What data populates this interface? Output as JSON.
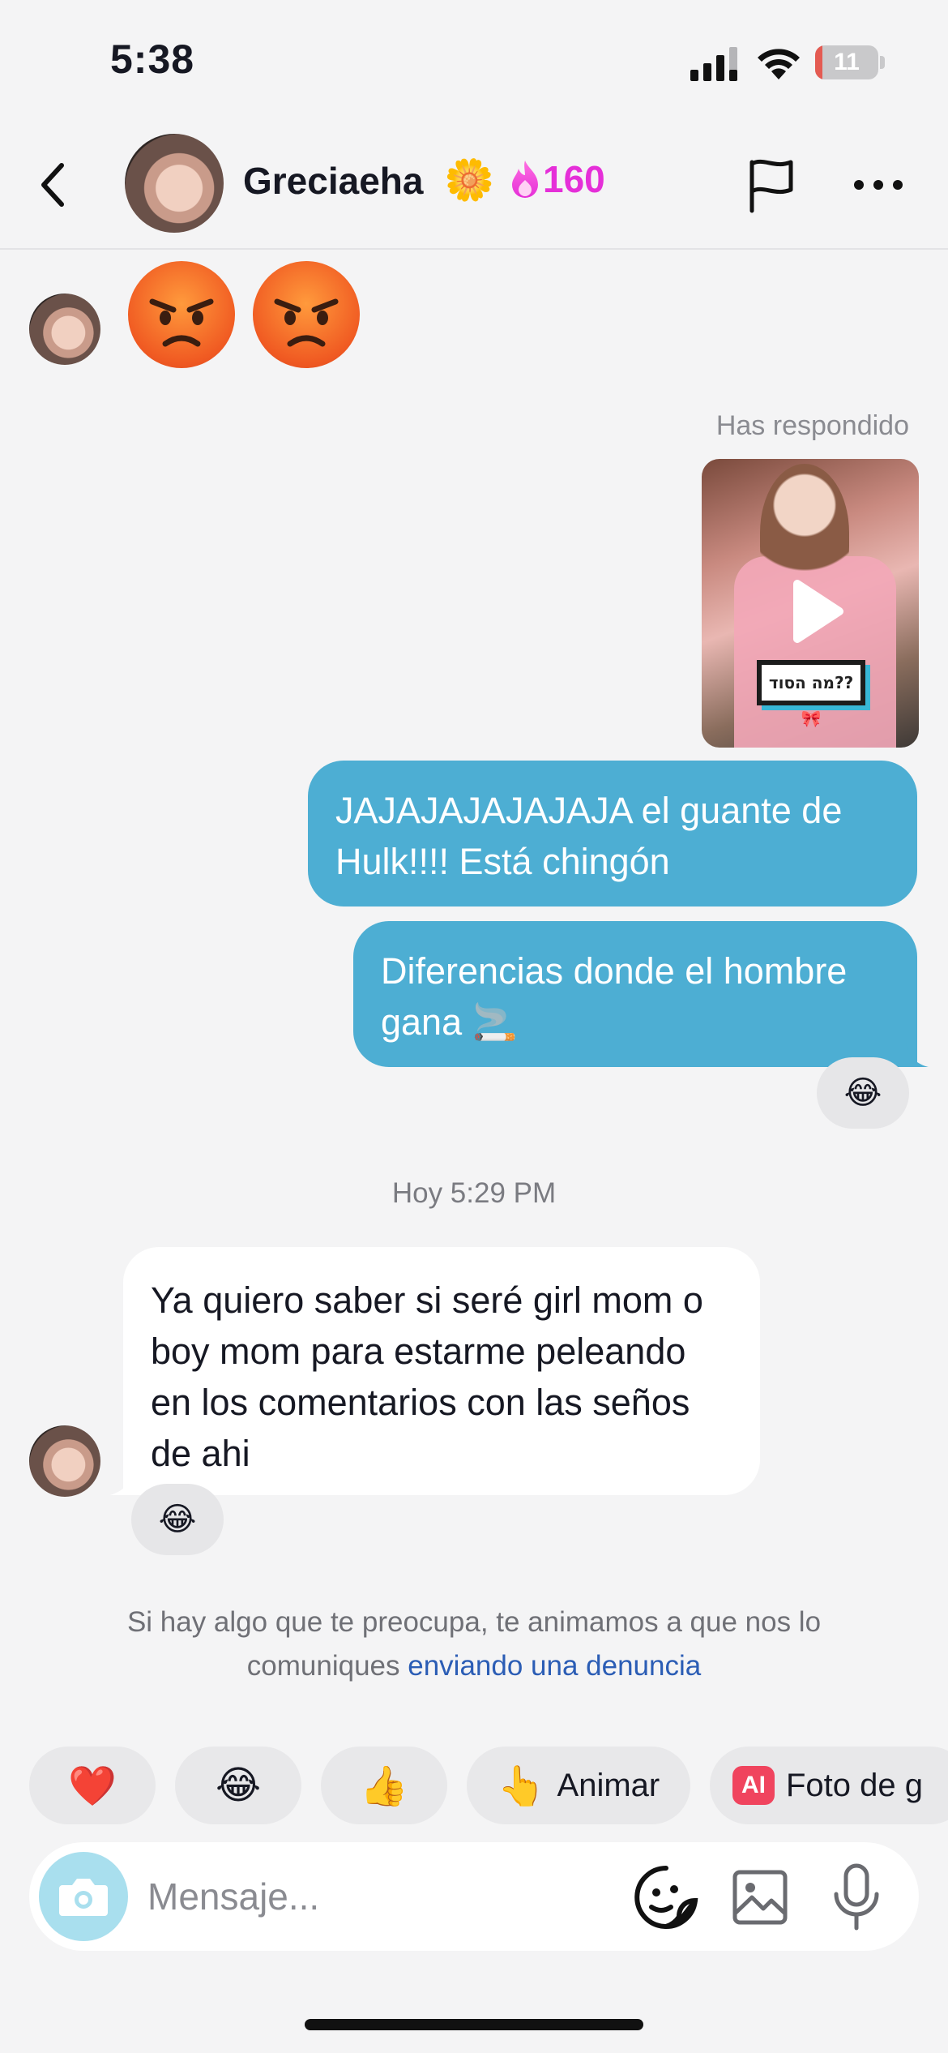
{
  "status_bar": {
    "time": "5:38",
    "battery": "11",
    "battery_level": 0.11
  },
  "header": {
    "name": "Greciaeha",
    "badge_emoji": "🌼",
    "streak_icon": "flame-icon",
    "streak_count": "160",
    "accent": "#e52fd8"
  },
  "messages": {
    "angry_emojis": [
      "😡",
      "😡"
    ],
    "replied_label": "Has respondido",
    "video_overlay": "מה הסוד??🎀",
    "out1": "JAJAJAJAJAJAJA el guante de Hulk!!!! Está chingón",
    "out2": "Diferencias donde el hombre gana 🚬",
    "reaction_out2": "😂",
    "timestamp": "Hoy 5:29 PM",
    "in1": "Ya quiero saber si seré girl mom o boy mom para estarme peleando en los comentarios con las seños de ahi",
    "reaction_in1": "😂"
  },
  "notice": {
    "text": "Si hay algo que te preocupa, te animamos a que nos lo comuniques ",
    "link": "enviando una denuncia"
  },
  "quick_replies": {
    "heart": "❤️",
    "laugh": "😂",
    "thumbs": "👍",
    "wave_emoji": "👆",
    "wave_label": "Animar",
    "ai_badge": "AI",
    "ai_label": "Foto de g"
  },
  "composer": {
    "placeholder": "Mensaje..."
  },
  "colors": {
    "outgoing_bubble": "#4daed3",
    "background": "#f4f4f5",
    "link": "#2b5db5"
  }
}
